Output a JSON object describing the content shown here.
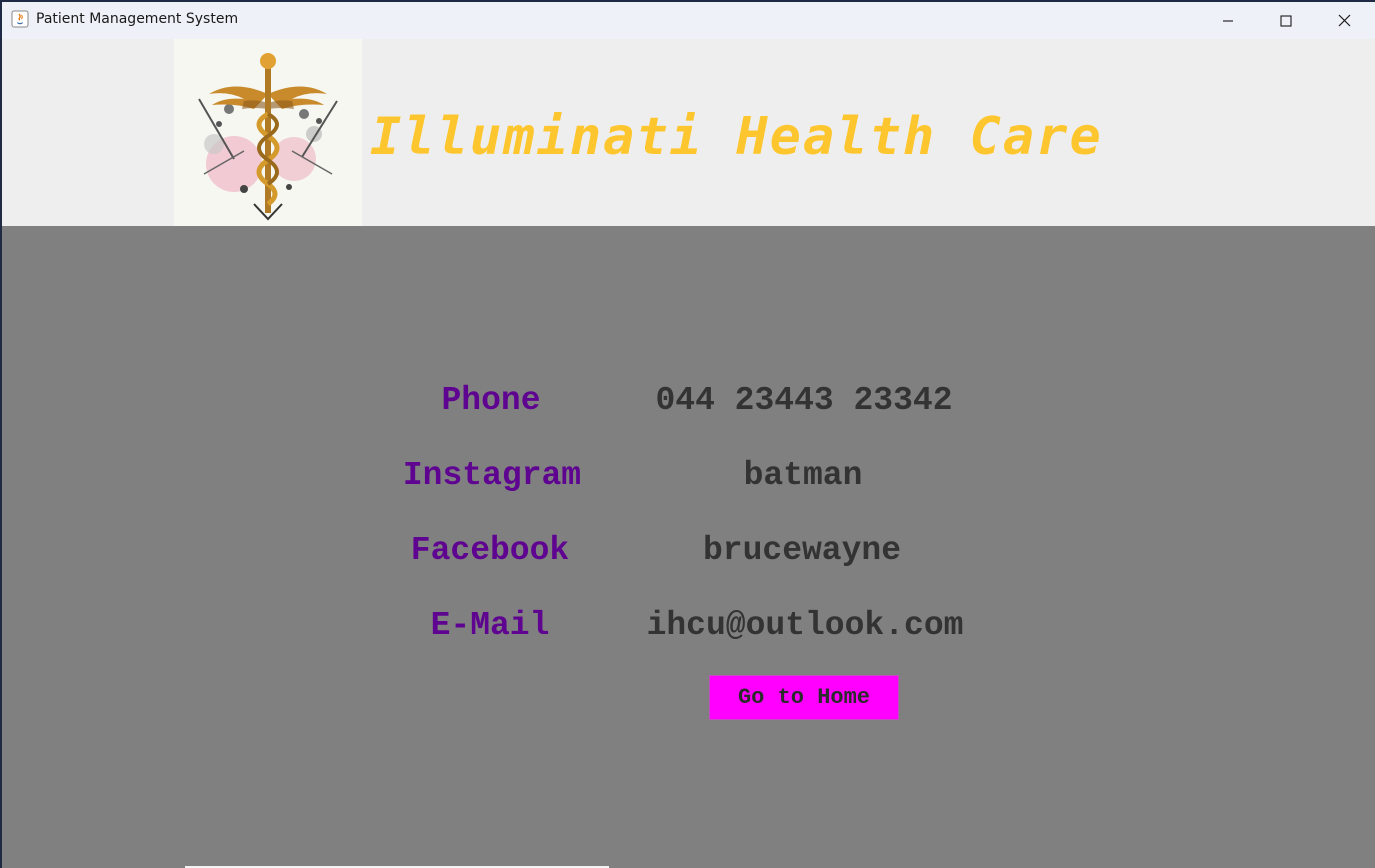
{
  "window": {
    "title": "Patient Management System"
  },
  "header": {
    "brand_name": "Illuminati Health Care",
    "logo_icon": "caduceus-icon"
  },
  "contact": {
    "rows": [
      {
        "label": "Phone",
        "value": "044 23443 23342"
      },
      {
        "label": "Instagram",
        "value": "batman"
      },
      {
        "label": "Facebook",
        "value": "brucewayne"
      },
      {
        "label": "E-Mail",
        "value": "ihcu@outlook.com"
      }
    ]
  },
  "actions": {
    "home_label": "Go to Home"
  },
  "colors": {
    "brand": "#fec62e",
    "label": "#5f0490",
    "value": "#333333",
    "button_bg": "#ff00ff",
    "content_bg": "#808080",
    "header_bg": "#eeeeee"
  }
}
